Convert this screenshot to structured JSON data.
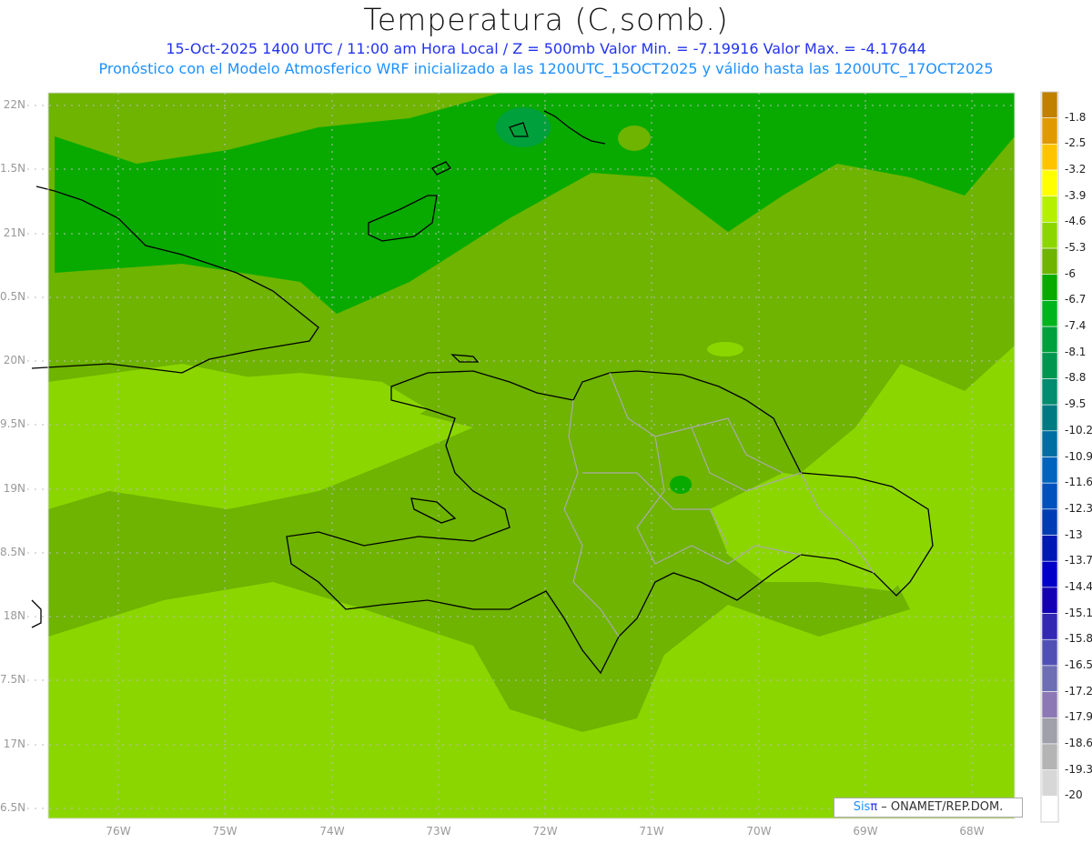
{
  "header": {
    "title": "Temperatura (C,somb.)",
    "line1": "15-Oct-2025  1400 UTC / 11:00 am Hora Local / Z = 500mb  Valor Min. = -7.19916  Valor Max. = -4.17644",
    "line2": "Pronóstico con el Modelo Atmosferico WRF inicializado a las 1200UTC_15OCT2025 y válido hasta las  1200UTC_17OCT2025"
  },
  "axes": {
    "lat_labels": [
      "22N",
      "1.5N",
      "21N",
      "0.5N",
      "20N",
      "9.5N",
      "19N",
      "8.5N",
      "18N",
      "7.5N",
      "17N",
      "6.5N"
    ],
    "lon_labels": [
      "76W",
      "75W",
      "74W",
      "73W",
      "72W",
      "71W",
      "70W",
      "69W",
      "68W"
    ]
  },
  "colorbar": {
    "labels": [
      "-1.8",
      "-2.5",
      "-3.2",
      "-3.9",
      "-4.6",
      "-5.3",
      "-6",
      "-6.7",
      "-7.4",
      "-8.1",
      "-8.8",
      "-9.5",
      "-10.2",
      "-10.9",
      "-11.6",
      "-12.3",
      "-13",
      "-13.7",
      "-14.4",
      "-15.1",
      "-15.8",
      "-16.5",
      "-17.2",
      "-17.9",
      "-18.6",
      "-19.3",
      "-20"
    ],
    "colors": [
      "#c08000",
      "#e09a00",
      "#ffc400",
      "#ffff00",
      "#b4f000",
      "#8cd600",
      "#6eb400",
      "#08aa00",
      "#00b41e",
      "#00a03c",
      "#009650",
      "#008c6e",
      "#007a82",
      "#006ea0",
      "#0064be",
      "#0050be",
      "#003cb4",
      "#0018b4",
      "#0000c8",
      "#1400b4",
      "#3228b4",
      "#5050b4",
      "#6e6eb4",
      "#8c78b4",
      "#a0a0aa",
      "#b4b4b4",
      "#d7d7d7",
      "#ffffff"
    ]
  },
  "footer": {
    "sis": "Sis",
    "pi": "π",
    "org": " – ONAMET/REP.DOM."
  }
}
